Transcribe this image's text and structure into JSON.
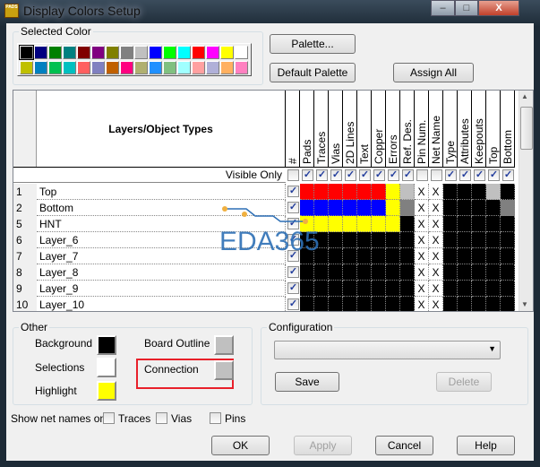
{
  "window": {
    "title": "Display Colors Setup",
    "app_icon": "PADS",
    "minimize": "–",
    "maximize": "□",
    "close": "X"
  },
  "selected_color": {
    "label": "Selected Color",
    "palette": [
      "#000000",
      "#000080",
      "#008000",
      "#008080",
      "#800000",
      "#800080",
      "#808000",
      "#808080",
      "#c0c0c0",
      "#0000ff",
      "#00ff00",
      "#00ffff",
      "#ff0000",
      "#ff00ff",
      "#ffff00",
      "#ffffff",
      "#c0c000",
      "#0080c0",
      "#00c050",
      "#00c0c0",
      "#ff6060",
      "#8080c0",
      "#c06000",
      "#ff0080",
      "#b0b070",
      "#2090ff",
      "#80c080",
      "#a0ffff",
      "#ffa0a0",
      "#b0b0d8",
      "#ffb060",
      "#ff80c0"
    ],
    "selected_index": 0
  },
  "buttons": {
    "palette": "Palette...",
    "default_palette": "Default Palette",
    "assign_all": "Assign All",
    "save": "Save",
    "delete": "Delete",
    "ok": "OK",
    "apply": "Apply",
    "cancel": "Cancel",
    "help": "Help"
  },
  "grid": {
    "title": "Layers/Object Types",
    "hash": "#",
    "visible_only": "Visible Only",
    "columns": [
      "Pads",
      "Traces",
      "Vias",
      "2D Lines",
      "Text",
      "Copper",
      "Errors",
      "Ref. Des.",
      "Pin Num.",
      "Net Name",
      "Type",
      "Attributes",
      "Keepouts",
      "Top",
      "Bottom"
    ],
    "visible_checks": [
      false,
      true,
      true,
      true,
      true,
      true,
      true,
      true,
      true,
      false,
      false,
      true,
      true,
      true,
      true,
      true
    ],
    "rows": [
      {
        "num": "1",
        "name": "Top",
        "visible": true,
        "colors": [
          "#ff0000",
          "#ff0000",
          "#ff0000",
          "#ff0000",
          "#ff0000",
          "#ff0000",
          "#ffff00",
          "#c0c0c0",
          "X",
          "X",
          "#000000",
          "#000000",
          "#000000",
          "#c0c0c0",
          "#000000"
        ]
      },
      {
        "num": "2",
        "name": "Bottom",
        "visible": true,
        "colors": [
          "#0000ff",
          "#0000ff",
          "#0000ff",
          "#0000ff",
          "#0000ff",
          "#0000ff",
          "#ffff00",
          "#808080",
          "X",
          "X",
          "#000000",
          "#000000",
          "#000000",
          "#000000",
          "#808080"
        ]
      },
      {
        "num": "5",
        "name": "HNT",
        "visible": true,
        "colors": [
          "#ffff00",
          "#ffff00",
          "#ffff00",
          "#ffff00",
          "#ffff00",
          "#ffff00",
          "#ffff00",
          "#000000",
          "X",
          "X",
          "#000000",
          "#000000",
          "#000000",
          "#000000",
          "#000000"
        ]
      },
      {
        "num": "6",
        "name": "Layer_6",
        "visible": true,
        "colors": [
          "#000000",
          "#000000",
          "#000000",
          "#000000",
          "#000000",
          "#000000",
          "#000000",
          "#000000",
          "X",
          "X",
          "#000000",
          "#000000",
          "#000000",
          "#000000",
          "#000000"
        ]
      },
      {
        "num": "7",
        "name": "Layer_7",
        "visible": true,
        "colors": [
          "#000000",
          "#000000",
          "#000000",
          "#000000",
          "#000000",
          "#000000",
          "#000000",
          "#000000",
          "X",
          "X",
          "#000000",
          "#000000",
          "#000000",
          "#000000",
          "#000000"
        ]
      },
      {
        "num": "8",
        "name": "Layer_8",
        "visible": true,
        "colors": [
          "#000000",
          "#000000",
          "#000000",
          "#000000",
          "#000000",
          "#000000",
          "#000000",
          "#000000",
          "X",
          "X",
          "#000000",
          "#000000",
          "#000000",
          "#000000",
          "#000000"
        ]
      },
      {
        "num": "9",
        "name": "Layer_9",
        "visible": true,
        "colors": [
          "#000000",
          "#000000",
          "#000000",
          "#000000",
          "#000000",
          "#000000",
          "#000000",
          "#000000",
          "X",
          "X",
          "#000000",
          "#000000",
          "#000000",
          "#000000",
          "#000000"
        ]
      },
      {
        "num": "10",
        "name": "Layer_10",
        "visible": true,
        "colors": [
          "#000000",
          "#000000",
          "#000000",
          "#000000",
          "#000000",
          "#000000",
          "#000000",
          "#000000",
          "X",
          "X",
          "#000000",
          "#000000",
          "#000000",
          "#000000",
          "#000000"
        ]
      }
    ]
  },
  "watermark": "EDA365",
  "other": {
    "label": "Other",
    "background": {
      "label": "Background",
      "color": "#000000"
    },
    "selections": {
      "label": "Selections",
      "color": "#ffffff"
    },
    "highlight": {
      "label": "Highlight",
      "color": "#ffff00"
    },
    "board_outline": {
      "label": "Board Outline",
      "color": "#c0c0c0"
    },
    "connection": {
      "label": "Connection",
      "color": "#c0c0c0"
    },
    "annotation_color": "#e8202a"
  },
  "configuration": {
    "label": "Configuration",
    "value": ""
  },
  "net_names": {
    "label": "Show net names on",
    "traces": "Traces",
    "vias": "Vias",
    "pins": "Pins",
    "traces_checked": false,
    "vias_checked": false,
    "pins_checked": false
  }
}
